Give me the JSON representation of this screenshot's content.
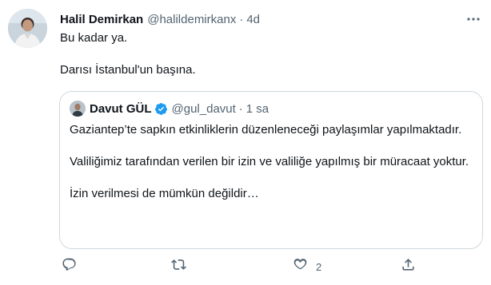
{
  "tweet": {
    "author_name": "Halil Demirkan",
    "author_handle": "@halildemirkanx",
    "separator": "·",
    "time": "4d",
    "text_lines": [
      "Bu kadar ya.",
      "Darısı İstanbul'un başına."
    ]
  },
  "quote": {
    "author_name": "Davut GÜL",
    "author_handle": "@gul_davut",
    "separator": "·",
    "time": "1 sa",
    "paragraphs": [
      "Gaziantep’te sapkın etkinliklerin düzenleneceği  paylaşımlar yapılmaktadır.",
      "Valiliğimiz tarafından verilen bir izin ve  valiliğe yapılmış bir müracaat yoktur.",
      "İzin verilmesi de mümkün değildir…"
    ]
  },
  "actions": {
    "reply_icon": "reply-icon",
    "retweet_icon": "retweet-icon",
    "like_icon": "heart-icon",
    "like_count": "2",
    "share_icon": "share-icon"
  },
  "colors": {
    "text": "#0f1419",
    "secondary": "#536471",
    "border": "#cfd9de",
    "verified": "#1d9bf0"
  }
}
